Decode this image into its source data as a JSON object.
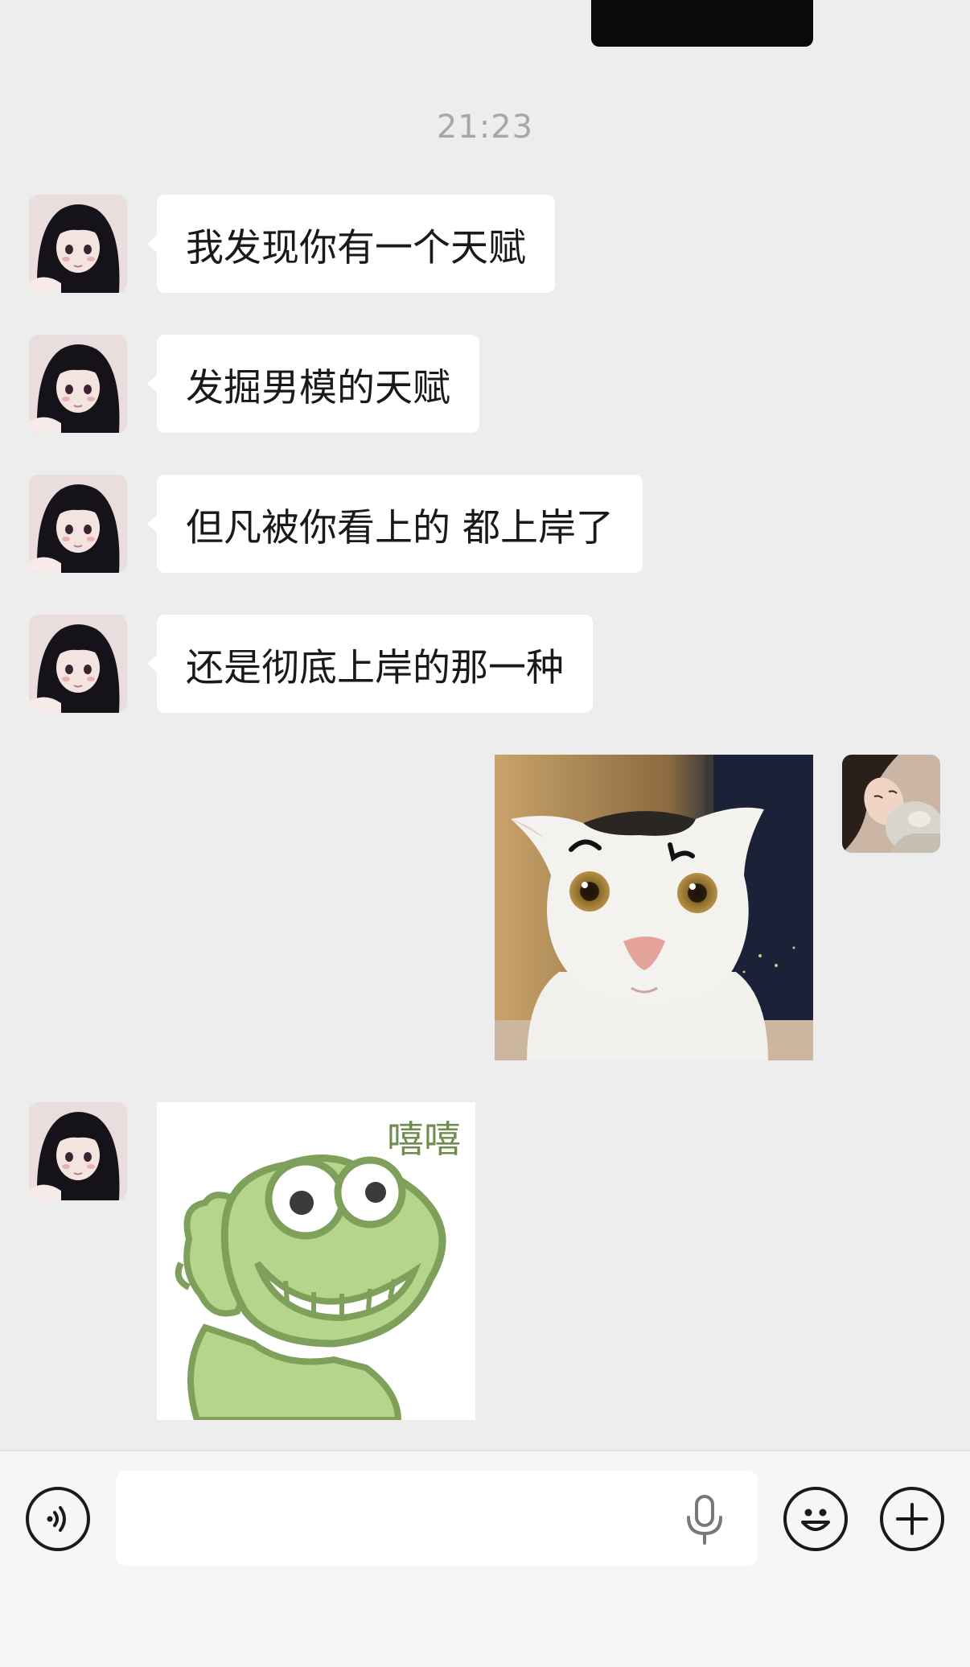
{
  "chat": {
    "timestamp": "21:23",
    "messages": [
      {
        "sender": "other",
        "type": "text",
        "text": "我发现你有一个天赋"
      },
      {
        "sender": "other",
        "type": "text",
        "text": "发掘男模的天赋"
      },
      {
        "sender": "other",
        "type": "text",
        "text": "但凡被你看上的 都上岸了"
      },
      {
        "sender": "other",
        "type": "text",
        "text": "还是彻底上岸的那一种"
      },
      {
        "sender": "self",
        "type": "image",
        "icon": "cat-meme-image"
      },
      {
        "sender": "other",
        "type": "sticker",
        "icon": "frog-sticker",
        "caption": "嘻嘻"
      }
    ]
  },
  "input_bar": {
    "text_value": "",
    "icons": [
      "voice-icon",
      "mic-icon",
      "emoji-icon",
      "plus-icon"
    ]
  },
  "colors": {
    "chat_background": "#ededed",
    "bubble_other": "#ffffff",
    "timestamp_text": "#a7a7a7",
    "input_bar_background": "#f6f6f6",
    "frog_green": "#b5d68a",
    "frog_outline": "#7ea05a"
  }
}
